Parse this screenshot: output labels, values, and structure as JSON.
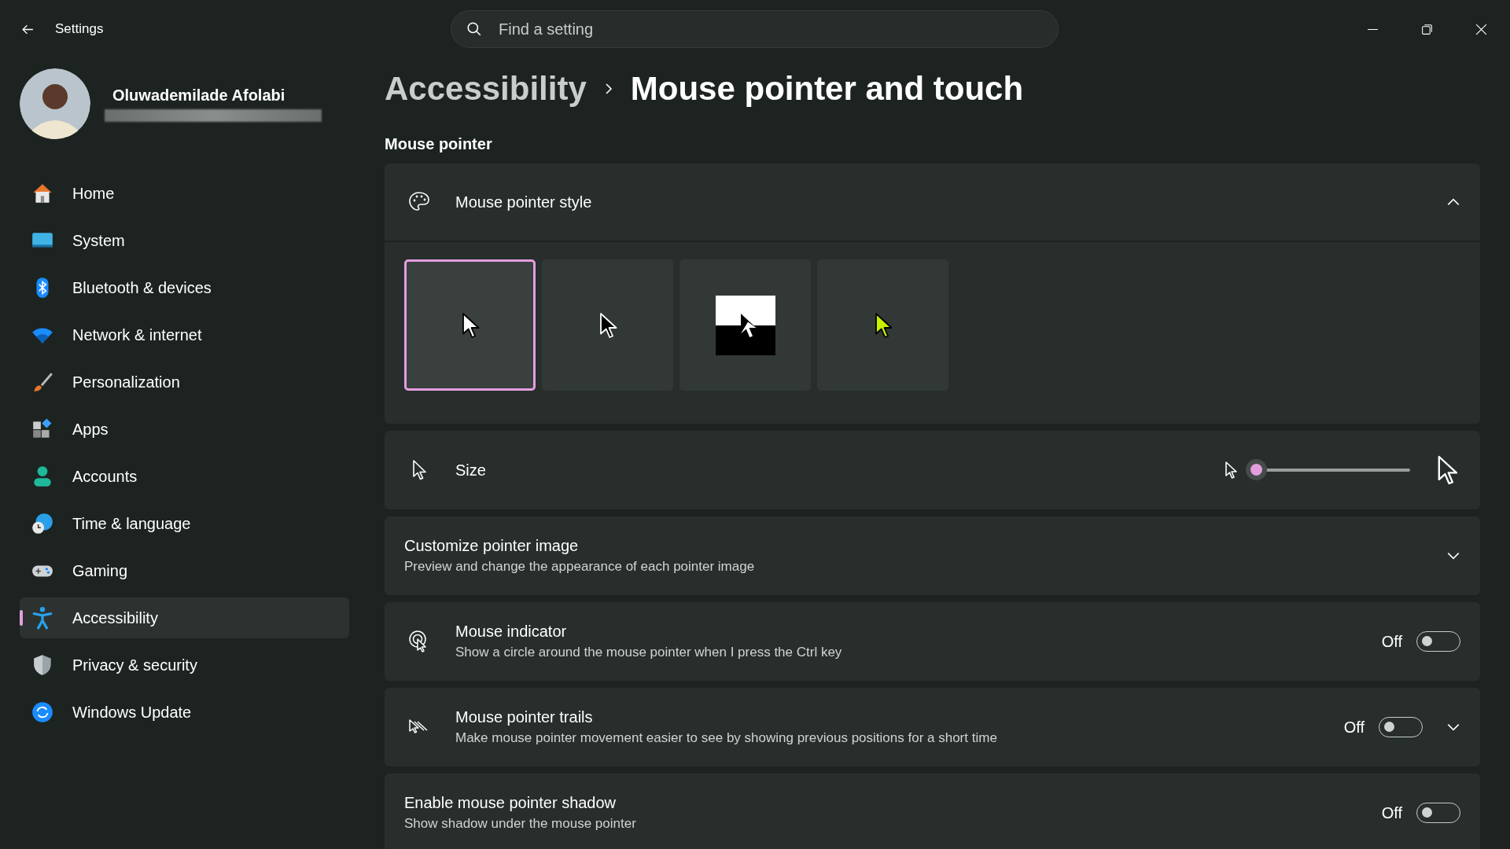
{
  "window": {
    "title": "Settings"
  },
  "search": {
    "placeholder": "Find a setting"
  },
  "user": {
    "name": "Oluwademilade Afolabi"
  },
  "sidebar": {
    "items": [
      {
        "label": "Home",
        "selected": false
      },
      {
        "label": "System",
        "selected": false
      },
      {
        "label": "Bluetooth & devices",
        "selected": false
      },
      {
        "label": "Network & internet",
        "selected": false
      },
      {
        "label": "Personalization",
        "selected": false
      },
      {
        "label": "Apps",
        "selected": false
      },
      {
        "label": "Accounts",
        "selected": false
      },
      {
        "label": "Time & language",
        "selected": false
      },
      {
        "label": "Gaming",
        "selected": false
      },
      {
        "label": "Accessibility",
        "selected": true
      },
      {
        "label": "Privacy & security",
        "selected": false
      },
      {
        "label": "Windows Update",
        "selected": false
      }
    ]
  },
  "breadcrumb": [
    "Accessibility",
    "Mouse pointer and touch"
  ],
  "section": "Mouse pointer",
  "settings": [
    {
      "kind": "style",
      "title": "Mouse pointer style",
      "expanded": true,
      "tiles": [
        {
          "kind": "white",
          "selected": true
        },
        {
          "kind": "black",
          "selected": false
        },
        {
          "kind": "inverted",
          "selected": false
        },
        {
          "kind": "custom",
          "selected": false
        }
      ]
    },
    {
      "kind": "slider",
      "title": "Size",
      "level": 0
    },
    {
      "kind": "expander",
      "title": "Customize pointer image",
      "description": "Preview and change the appearance of each pointer image",
      "expanded": false
    },
    {
      "kind": "toggle",
      "title": "Mouse indicator",
      "description": "Show a circle around the mouse pointer when I press the Ctrl key",
      "state": "Off",
      "on": false
    },
    {
      "kind": "toggle",
      "title": "Mouse pointer trails",
      "description": "Make mouse pointer movement easier to see by showing previous positions for a short time",
      "state": "Off",
      "on": false,
      "expanded": false
    },
    {
      "kind": "toggle",
      "title": "Enable mouse pointer shadow",
      "description": "Show shadow under the mouse pointer",
      "state": "Off",
      "on": false
    }
  ]
}
